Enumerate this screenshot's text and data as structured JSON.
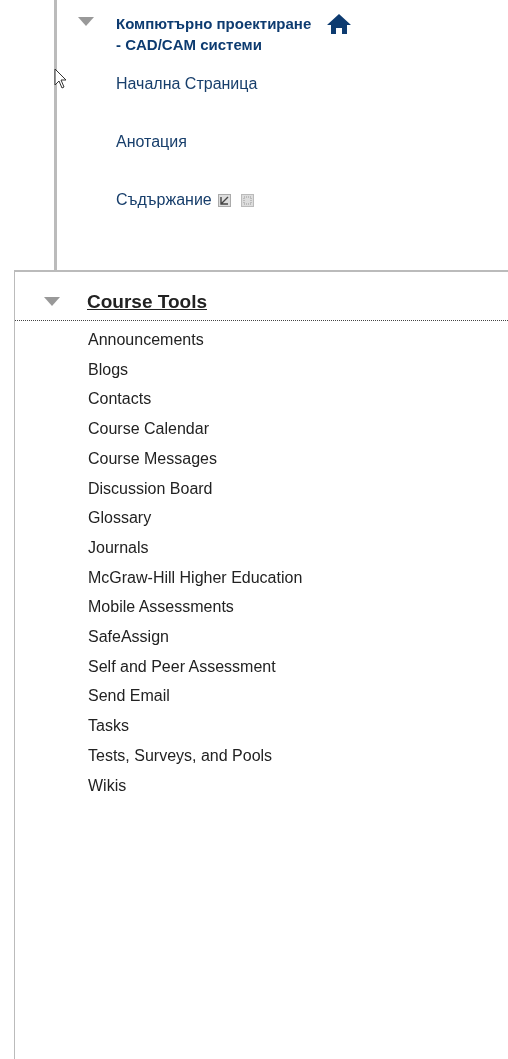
{
  "course_menu": {
    "title": "Компютърно проектиране - CAD/CAM системи",
    "expanded": true,
    "items": [
      {
        "label": "Начална Страница",
        "kind": "link"
      },
      {
        "label": "Анотация",
        "kind": "link"
      },
      {
        "label": "Съдържание",
        "kind": "content"
      }
    ]
  },
  "course_tools": {
    "title": "Course Tools",
    "expanded": true,
    "items": [
      "Announcements",
      "Blogs",
      "Contacts",
      "Course Calendar",
      "Course Messages",
      "Discussion Board",
      "Glossary",
      "Journals",
      "McGraw-Hill Higher Education",
      "Mobile Assessments",
      "SafeAssign",
      "Self and Peer Assessment",
      "Send Email",
      "Tasks",
      "Tests, Surveys, and Pools",
      "Wikis"
    ]
  }
}
